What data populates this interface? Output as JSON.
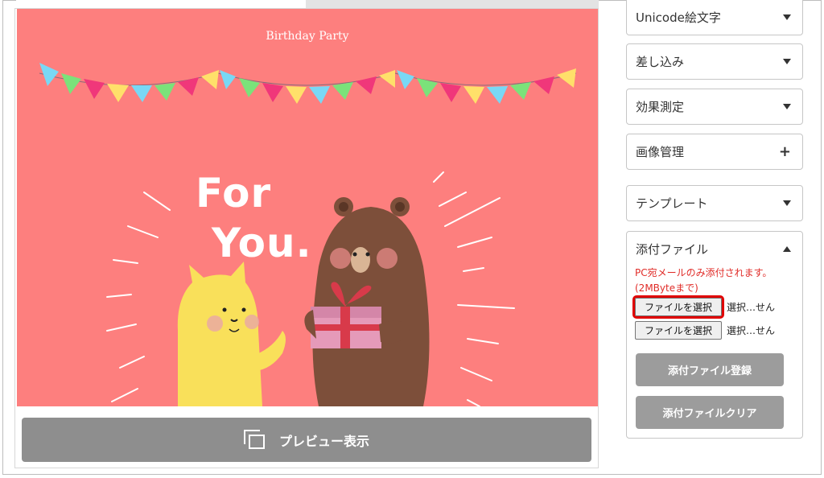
{
  "card": {
    "title": "Birthday Party",
    "headline_line1": "For",
    "headline_line2": "You."
  },
  "preview_button": {
    "label": "プレビュー表示",
    "icon": "preview-windows-icon"
  },
  "sidebar": {
    "panels": [
      {
        "label": "Unicode絵文字",
        "icon": "caret-down-icon"
      },
      {
        "label": "差し込み",
        "icon": "caret-down-icon"
      },
      {
        "label": "効果測定",
        "icon": "caret-down-icon"
      },
      {
        "label": "画像管理",
        "icon": "plus-icon"
      },
      {
        "label": "テンプレート",
        "icon": "caret-down-icon"
      }
    ],
    "attachment": {
      "label": "添付ファイル",
      "icon": "caret-up-icon",
      "note_line1": "PC宛メールのみ添付されます。",
      "note_line2": "(2MByteまで)",
      "file_inputs": [
        {
          "button": "ファイルを選択",
          "status": "選択…せん",
          "highlighted": true
        },
        {
          "button": "ファイルを選択",
          "status": "選択…せん",
          "highlighted": false
        }
      ],
      "register_button": "添付ファイル登録",
      "clear_button": "添付ファイルクリア"
    }
  },
  "colors": {
    "card_background": "#fd7f7e",
    "highlight": "#e00000",
    "note_text": "#e02b27",
    "button_gray": "#9c9c9c"
  }
}
